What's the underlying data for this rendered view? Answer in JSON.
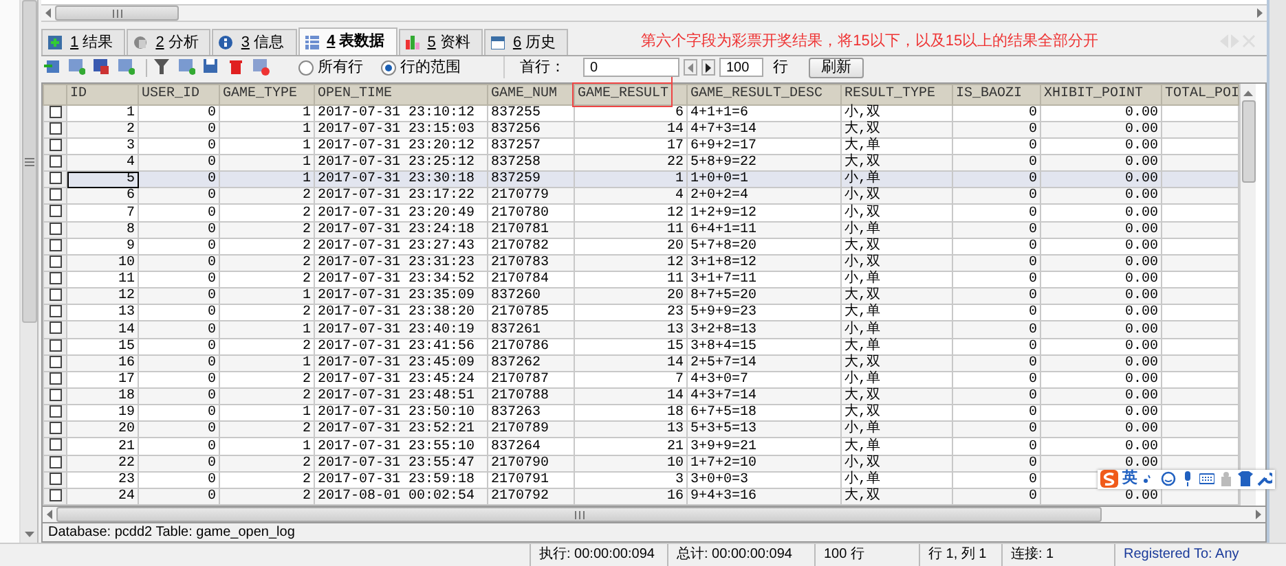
{
  "tabs": [
    {
      "key": "1",
      "label": "结果",
      "selected": false
    },
    {
      "key": "2",
      "label": "分析",
      "selected": false
    },
    {
      "key": "3",
      "label": "信息",
      "selected": false
    },
    {
      "key": "4",
      "label": "表数据",
      "selected": true
    },
    {
      "key": "5",
      "label": "资料",
      "selected": false
    },
    {
      "key": "6",
      "label": "历史",
      "selected": false
    }
  ],
  "annotation": {
    "note": "第六个字段为彩票开奖结果，将15以下，以及15以上的结果全部分开"
  },
  "toolbar": {
    "range_options": [
      {
        "label": "所有行",
        "selected": false
      },
      {
        "label": "行的范围",
        "selected": true
      }
    ],
    "first_row_label": "首行：",
    "first_row_value": "0",
    "row_count_value": "100",
    "row_count_unit": "行",
    "refresh_button": "刷新"
  },
  "table": {
    "columns": [
      "ID",
      "USER_ID",
      "GAME_TYPE",
      "OPEN_TIME",
      "GAME_NUM",
      "GAME_RESULT",
      "GAME_RESULT_DESC",
      "RESULT_TYPE",
      "IS_BAOZI",
      "XHIBIT_POINT",
      "TOTAL_POI"
    ],
    "rows": [
      {
        "checked": false,
        "selected": false,
        "cells": [
          "1",
          "0",
          "1",
          "2017-07-31 23:10:12",
          "837255",
          "6",
          "4+1+1=6",
          "小,双",
          "0",
          "0.00"
        ]
      },
      {
        "checked": false,
        "selected": false,
        "cells": [
          "2",
          "0",
          "1",
          "2017-07-31 23:15:03",
          "837256",
          "14",
          "4+7+3=14",
          "大,双",
          "0",
          "0.00"
        ]
      },
      {
        "checked": false,
        "selected": false,
        "cells": [
          "3",
          "0",
          "1",
          "2017-07-31 23:20:12",
          "837257",
          "17",
          "6+9+2=17",
          "大,单",
          "0",
          "0.00"
        ]
      },
      {
        "checked": false,
        "selected": false,
        "cells": [
          "4",
          "0",
          "1",
          "2017-07-31 23:25:12",
          "837258",
          "22",
          "5+8+9=22",
          "大,双",
          "0",
          "0.00"
        ]
      },
      {
        "checked": false,
        "selected": true,
        "cells": [
          "5",
          "0",
          "1",
          "2017-07-31 23:30:18",
          "837259",
          "1",
          "1+0+0=1",
          "小,单",
          "0",
          "0.00"
        ]
      },
      {
        "checked": false,
        "selected": false,
        "cells": [
          "6",
          "0",
          "2",
          "2017-07-31 23:17:22",
          "2170779",
          "4",
          "2+0+2=4",
          "小,双",
          "0",
          "0.00"
        ]
      },
      {
        "checked": false,
        "selected": false,
        "cells": [
          "7",
          "0",
          "2",
          "2017-07-31 23:20:49",
          "2170780",
          "12",
          "1+2+9=12",
          "小,双",
          "0",
          "0.00"
        ]
      },
      {
        "checked": false,
        "selected": false,
        "cells": [
          "8",
          "0",
          "2",
          "2017-07-31 23:24:18",
          "2170781",
          "11",
          "6+4+1=11",
          "小,单",
          "0",
          "0.00"
        ]
      },
      {
        "checked": false,
        "selected": false,
        "cells": [
          "9",
          "0",
          "2",
          "2017-07-31 23:27:43",
          "2170782",
          "20",
          "5+7+8=20",
          "大,双",
          "0",
          "0.00"
        ]
      },
      {
        "checked": false,
        "selected": false,
        "cells": [
          "10",
          "0",
          "2",
          "2017-07-31 23:31:23",
          "2170783",
          "12",
          "3+1+8=12",
          "小,双",
          "0",
          "0.00"
        ]
      },
      {
        "checked": false,
        "selected": false,
        "cells": [
          "11",
          "0",
          "2",
          "2017-07-31 23:34:52",
          "2170784",
          "11",
          "3+1+7=11",
          "小,单",
          "0",
          "0.00"
        ]
      },
      {
        "checked": false,
        "selected": false,
        "cells": [
          "12",
          "0",
          "1",
          "2017-07-31 23:35:09",
          "837260",
          "20",
          "8+7+5=20",
          "大,双",
          "0",
          "0.00"
        ]
      },
      {
        "checked": false,
        "selected": false,
        "cells": [
          "13",
          "0",
          "2",
          "2017-07-31 23:38:20",
          "2170785",
          "23",
          "5+9+9=23",
          "大,单",
          "0",
          "0.00"
        ]
      },
      {
        "checked": false,
        "selected": false,
        "cells": [
          "14",
          "0",
          "1",
          "2017-07-31 23:40:19",
          "837261",
          "13",
          "3+2+8=13",
          "小,单",
          "0",
          "0.00"
        ]
      },
      {
        "checked": false,
        "selected": false,
        "cells": [
          "15",
          "0",
          "2",
          "2017-07-31 23:41:56",
          "2170786",
          "15",
          "3+8+4=15",
          "大,单",
          "0",
          "0.00"
        ]
      },
      {
        "checked": false,
        "selected": false,
        "cells": [
          "16",
          "0",
          "1",
          "2017-07-31 23:45:09",
          "837262",
          "14",
          "2+5+7=14",
          "大,双",
          "0",
          "0.00"
        ]
      },
      {
        "checked": false,
        "selected": false,
        "cells": [
          "17",
          "0",
          "2",
          "2017-07-31 23:45:24",
          "2170787",
          "7",
          "4+3+0=7",
          "小,单",
          "0",
          "0.00"
        ]
      },
      {
        "checked": false,
        "selected": false,
        "cells": [
          "18",
          "0",
          "2",
          "2017-07-31 23:48:51",
          "2170788",
          "14",
          "4+3+7=14",
          "大,双",
          "0",
          "0.00"
        ]
      },
      {
        "checked": false,
        "selected": false,
        "cells": [
          "19",
          "0",
          "1",
          "2017-07-31 23:50:10",
          "837263",
          "18",
          "6+7+5=18",
          "大,双",
          "0",
          "0.00"
        ]
      },
      {
        "checked": false,
        "selected": false,
        "cells": [
          "20",
          "0",
          "2",
          "2017-07-31 23:52:21",
          "2170789",
          "13",
          "5+3+5=13",
          "小,单",
          "0",
          "0.00"
        ]
      },
      {
        "checked": false,
        "selected": false,
        "cells": [
          "21",
          "0",
          "1",
          "2017-07-31 23:55:10",
          "837264",
          "21",
          "3+9+9=21",
          "大,单",
          "0",
          "0.00"
        ]
      },
      {
        "checked": false,
        "selected": false,
        "cells": [
          "22",
          "0",
          "2",
          "2017-07-31 23:55:47",
          "2170790",
          "10",
          "1+7+2=10",
          "小,双",
          "0",
          "0.00"
        ]
      },
      {
        "checked": false,
        "selected": false,
        "cells": [
          "23",
          "0",
          "2",
          "2017-07-31 23:59:18",
          "2170791",
          "3",
          "3+0+0=3",
          "小,单",
          "0",
          null
        ]
      },
      {
        "checked": false,
        "selected": false,
        "cells": [
          "24",
          "0",
          "2",
          "2017-08-01 00:02:54",
          "2170792",
          "16",
          "9+4+3=16",
          "大,双",
          "0",
          "0.00"
        ]
      }
    ]
  },
  "info_line": "Database: pcdd2 Table: game_open_log",
  "ime_toolbar": {
    "mode": "英"
  },
  "status_bar": [
    {
      "kind": "plain",
      "text": "执行: 00:00:00:094"
    },
    {
      "kind": "plain",
      "text": "总计: 00:00:00:094"
    },
    {
      "kind": "plain",
      "text": "100 行"
    },
    {
      "kind": "plain",
      "text": "行 1, 列 1"
    },
    {
      "kind": "plain",
      "text": "连接: 1"
    },
    {
      "kind": "link",
      "text": "Registered To: Any"
    }
  ]
}
